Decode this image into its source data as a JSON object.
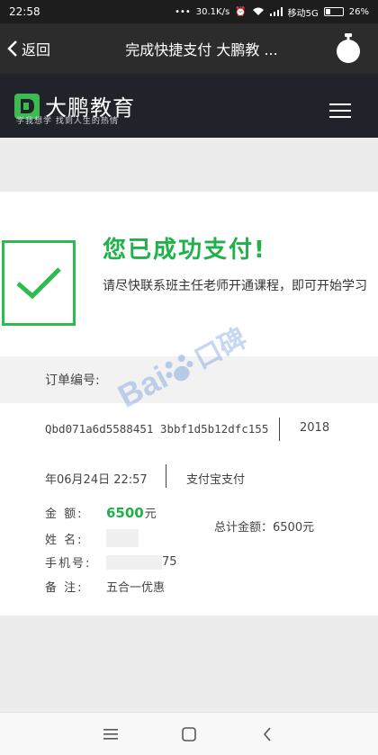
{
  "status": {
    "time": "22:58",
    "speed": "30.1K/s",
    "carrier": "移动5G",
    "battery": "26%"
  },
  "titlebar": {
    "back_label": "返回",
    "title": "完成快捷支付 大鹏教 ..."
  },
  "site": {
    "brand": "大鹏教育",
    "slogan": "学我想学  找到人生的热情"
  },
  "success": {
    "title": "您已成功支付!",
    "hint": "请尽快联系班主任老师开通课程，即可开始学习"
  },
  "order": {
    "label": "订单编号:",
    "id": "Qbd071a6d5588451 3bbf1d5b12dfc155",
    "year": "2018",
    "time": "年06月24日 22:57",
    "pay_method": "支付宝支付",
    "amount_label": "金  额:",
    "amount": "6500",
    "amount_unit": "元",
    "name_label": "姓  名:",
    "phone_label": "手机号:",
    "phone_tail": "75",
    "note_label": "备  注:",
    "note": "五合一优惠",
    "total": "总计金额：6500元"
  },
  "watermark": {
    "text": "Bai",
    "cn": "口碑"
  },
  "colors": {
    "accent": "#21b14a",
    "header": "#20232a",
    "titlebar": "#2c2c2c"
  }
}
